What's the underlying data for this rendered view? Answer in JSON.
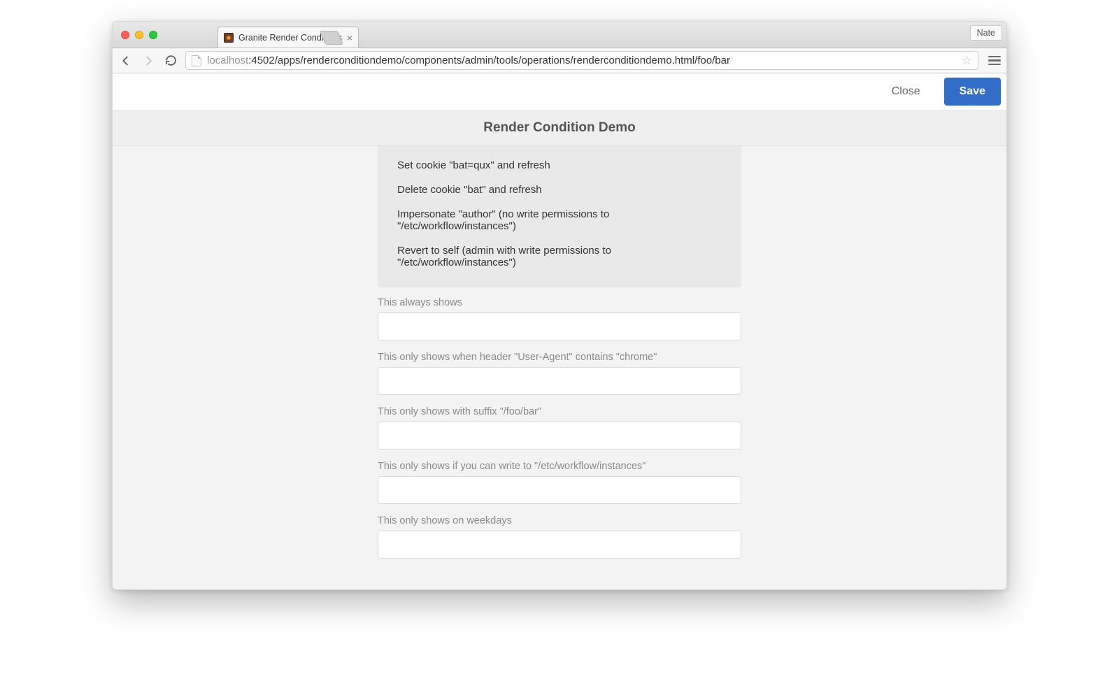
{
  "browser": {
    "tab_title": "Granite Render Conditions",
    "profile_name": "Nate",
    "url_host": "localhost",
    "url_path": ":4502/apps/renderconditiondemo/components/admin/tools/operations/renderconditiondemo.html/foo/bar"
  },
  "actionbar": {
    "close_label": "Close",
    "save_label": "Save"
  },
  "page": {
    "title": "Render Condition Demo"
  },
  "links": [
    {
      "label": "Set cookie \"bat=qux\" and refresh"
    },
    {
      "label": "Delete cookie \"bat\" and refresh"
    },
    {
      "label": "Impersonate \"author\" (no write permissions to \"/etc/workflow/instances\")"
    },
    {
      "label": "Revert to self (admin with write permissions to \"/etc/workflow/instances\")"
    }
  ],
  "fields": [
    {
      "label": "This always shows",
      "value": ""
    },
    {
      "label": "This only shows when header \"User-Agent\" contains \"chrome\"",
      "value": ""
    },
    {
      "label": "This only shows with suffix \"/foo/bar\"",
      "value": ""
    },
    {
      "label": "This only shows if you can write to \"/etc/workflow/instances\"",
      "value": ""
    },
    {
      "label": "This only shows on weekdays",
      "value": ""
    }
  ]
}
